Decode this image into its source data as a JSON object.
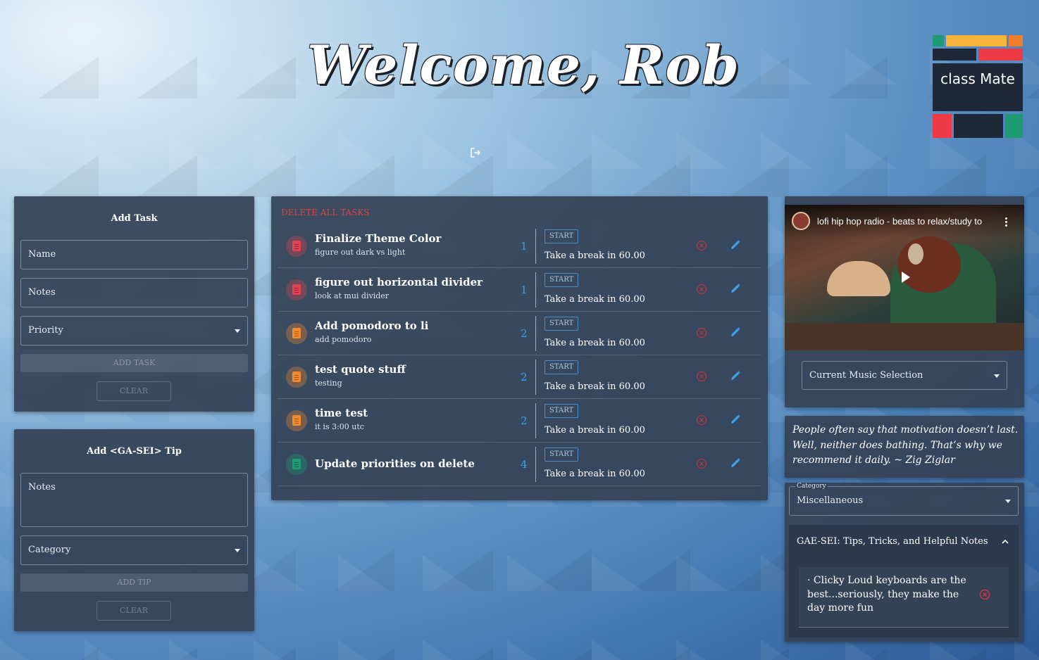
{
  "header": {
    "welcome": "Welcome, Rob",
    "logout_icon": "logout-icon"
  },
  "logo": {
    "text": "class Mate",
    "colors": {
      "teal": "#1f9b73",
      "yellow": "#f7b43b",
      "orange": "#f17e2c",
      "navy": "#1f2838",
      "red": "#ee3a45"
    }
  },
  "add_task": {
    "title": "Add Task",
    "name_placeholder": "Name",
    "notes_placeholder": "Notes",
    "priority_placeholder": "Priority",
    "add_label": "ADD TASK",
    "clear_label": "CLEAR"
  },
  "add_tip": {
    "title": "Add <GA-SEI> Tip",
    "notes_placeholder": "Notes",
    "category_placeholder": "Category",
    "add_label": "ADD TIP",
    "clear_label": "CLEAR"
  },
  "tasks": {
    "delete_all_label": "DELETE ALL TASKS",
    "items": [
      {
        "name": "Finalize Theme Color",
        "notes": "figure out dark vs light",
        "priority": "1",
        "start": "START",
        "break": "Take a break in 60.00",
        "color": "#e04252"
      },
      {
        "name": "figure out horizontal divider",
        "notes": "look at mui divider",
        "priority": "1",
        "start": "START",
        "break": "Take a break in 60.00",
        "color": "#e04252"
      },
      {
        "name": "Add pomodoro to li",
        "notes": "add pomodoro",
        "priority": "2",
        "start": "START",
        "break": "Take a break in 60.00",
        "color": "#f08a2c"
      },
      {
        "name": "test quote stuff",
        "notes": "testing",
        "priority": "2",
        "start": "START",
        "break": "Take a break in 60.00",
        "color": "#f08a2c"
      },
      {
        "name": "time test",
        "notes": "it is 3:00 utc",
        "priority": "2",
        "start": "START",
        "break": "Take a break in 60.00",
        "color": "#f08a2c"
      },
      {
        "name": "Update priorities on delete",
        "notes": "",
        "priority": "4",
        "start": "START",
        "break": "Take a break in 60.00",
        "color": "#1f9b73"
      }
    ]
  },
  "music": {
    "video_title": "lofi hip hop radio - beats to relax/study to",
    "selection_label": "Current Music Selection"
  },
  "quote": {
    "text": "People often say that motivation doesn’t last. Well, neither does bathing. That’s why we recommend it daily. ~ Zig Ziglar"
  },
  "tips": {
    "category_label": "Category",
    "category_value": "Miscellaneous",
    "section_title": "GAE-SEI: Tips, Tricks, and Helpful Notes",
    "items": [
      {
        "text": "· Clicky Loud keyboards are the best...seriously, they make the day more fun"
      }
    ]
  }
}
